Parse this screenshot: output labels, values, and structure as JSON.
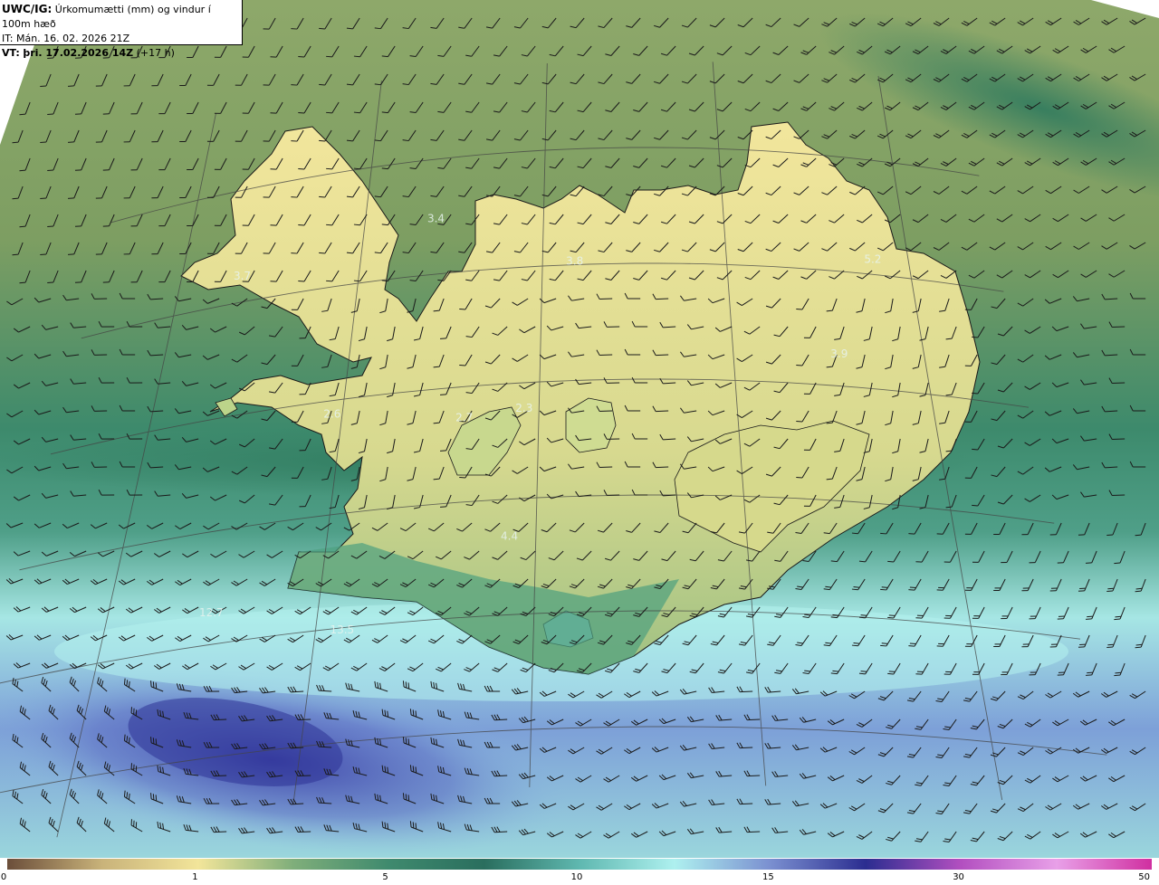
{
  "header": {
    "model": "UWC/IG:",
    "title": "Úrkomumætti (mm) og vindur í 100m hæð",
    "init_time": "IT: Mán. 16. 02. 2026 21Z",
    "valid_prefix": "VT:",
    "valid_time": "þri. 17.02.2026 14Z",
    "lead_time": "(+17 h)"
  },
  "map_labels": [
    {
      "text": "3.4",
      "lon": -22.4,
      "lat": 66.45
    },
    {
      "text": "3.7",
      "lon": -26.6,
      "lat": 66.2
    },
    {
      "text": "3.8",
      "lon": -19.3,
      "lat": 66.0
    },
    {
      "text": "5.2",
      "lon": -12.8,
      "lat": 66.1
    },
    {
      "text": "3.9",
      "lon": -13.8,
      "lat": 65.25
    },
    {
      "text": "2.6",
      "lon": -24.2,
      "lat": 64.85
    },
    {
      "text": "2.7",
      "lon": -21.5,
      "lat": 64.7
    },
    {
      "text": "2.3",
      "lon": -20.3,
      "lat": 64.75
    },
    {
      "text": "4.4",
      "lon": -20.5,
      "lat": 63.65
    },
    {
      "text": "12.7",
      "lon": -26.0,
      "lat": 63.25
    },
    {
      "text": "13.5",
      "lon": -23.5,
      "lat": 62.95
    }
  ],
  "colorbar": {
    "ticks": [
      "0",
      "1",
      "5",
      "10",
      "15",
      "30",
      "50"
    ],
    "stops": [
      "#6b4e3a",
      "#c9b37a",
      "#f2e59a",
      "#7fae7a",
      "#3f8a6e",
      "#2a6e5e",
      "#5fb8b0",
      "#aef0ef",
      "#7a8fd0",
      "#2b2d90",
      "#b24fc0",
      "#e8a0e8",
      "#d02fa0"
    ]
  },
  "colors": {
    "land_low": "#f3e59a",
    "sea_green": "#3c8c6a",
    "sea_cyan": "#aaeeee",
    "sea_blue": "#5b63c0"
  }
}
